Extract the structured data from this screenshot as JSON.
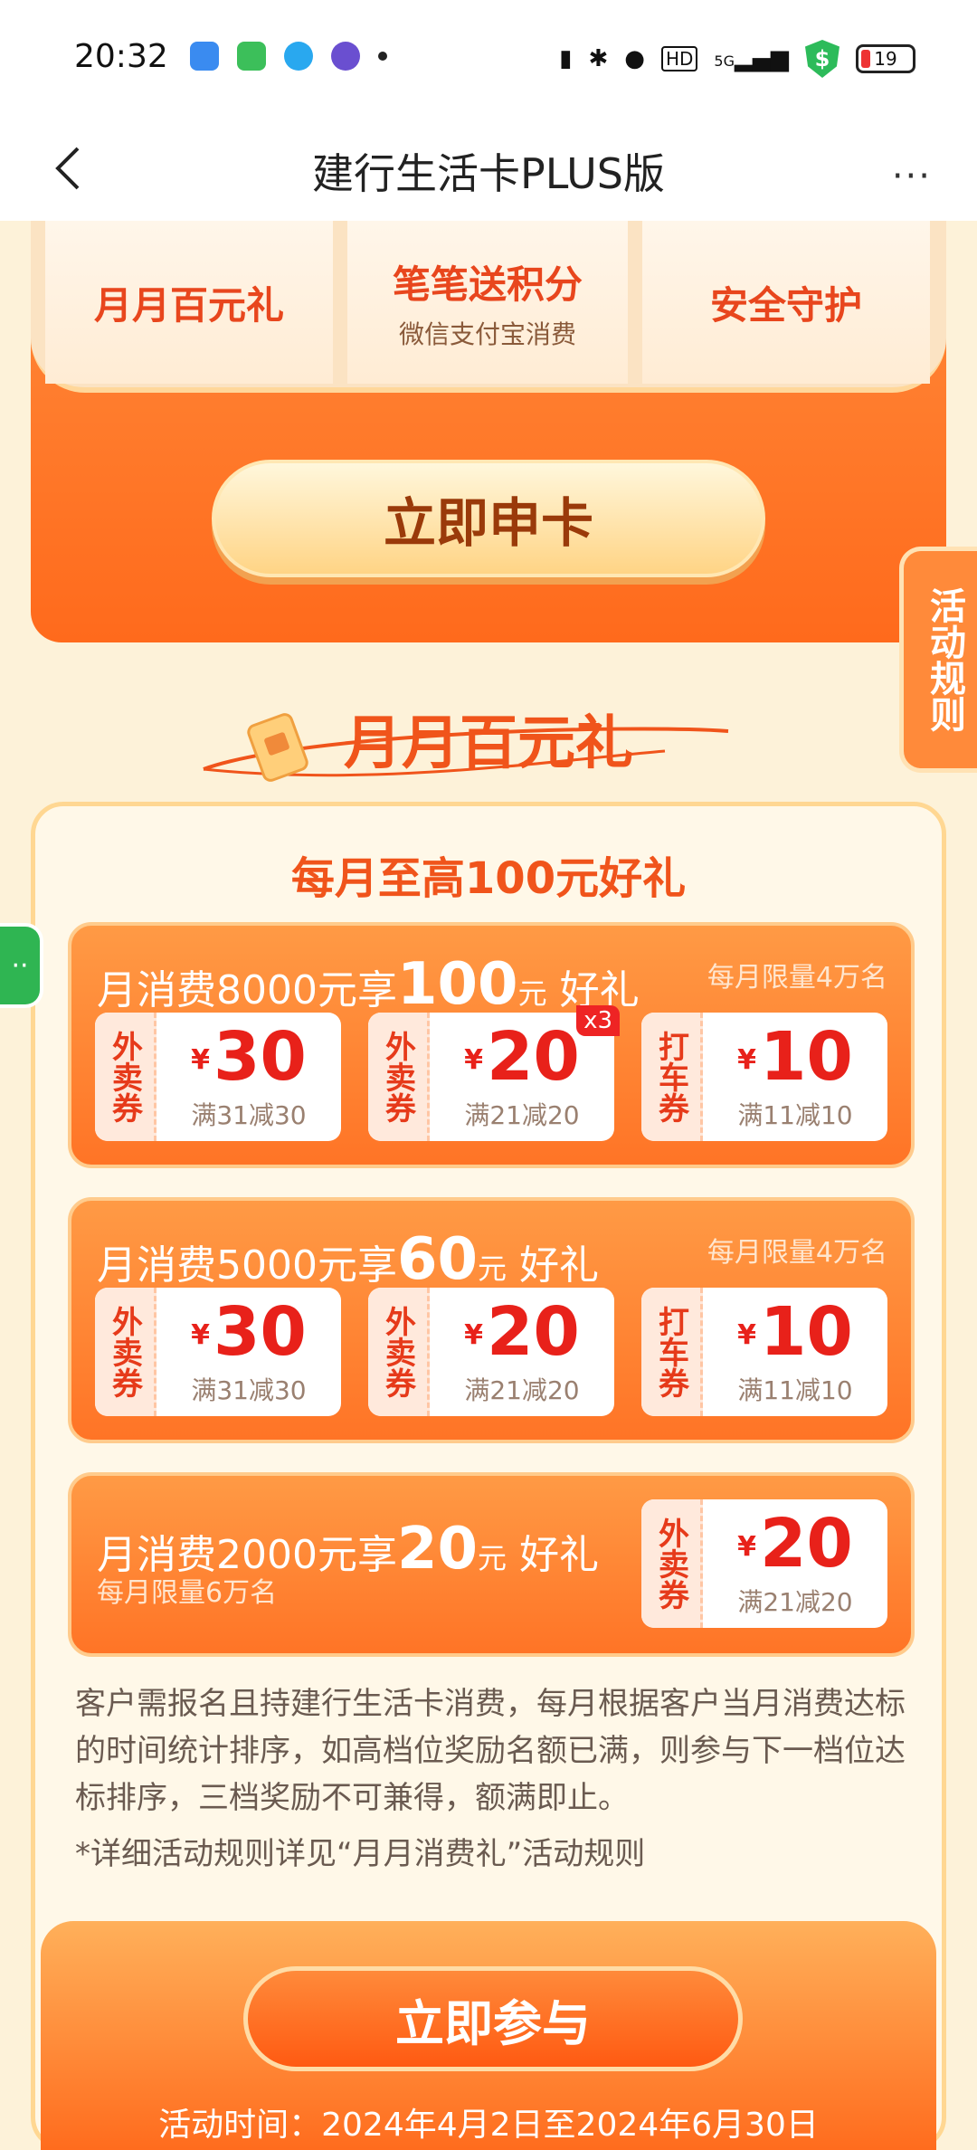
{
  "status_bar": {
    "time": "20:32",
    "battery": "19",
    "network": "5G",
    "hd": "HD",
    "shield_symbol": "$"
  },
  "titlebar": {
    "title": "建行生活卡PLUS版",
    "more": "···"
  },
  "features": [
    {
      "title": "月月百元礼",
      "sub": ""
    },
    {
      "title": "笔笔送积分",
      "sub": "微信支付宝消费"
    },
    {
      "title": "安全守护",
      "sub": ""
    }
  ],
  "apply_button": "立即申卡",
  "rules_tab": "活动规则",
  "section": {
    "title": "月月百元礼",
    "head": "每月至高100元好礼"
  },
  "tiers": [
    {
      "prefix": "月消费8000元享",
      "amount": "100",
      "unit": "元",
      "suffix": "好礼",
      "limit": "每月限量4万名",
      "coupons": [
        {
          "type": "外卖券",
          "value": "30",
          "cond": "满31减30",
          "badge": ""
        },
        {
          "type": "外卖券",
          "value": "20",
          "cond": "满21减20",
          "badge": "x3"
        },
        {
          "type": "打车券",
          "value": "10",
          "cond": "满11减10",
          "badge": ""
        }
      ]
    },
    {
      "prefix": "月消费5000元享",
      "amount": "60",
      "unit": "元",
      "suffix": "好礼",
      "limit": "每月限量4万名",
      "coupons": [
        {
          "type": "外卖券",
          "value": "30",
          "cond": "满31减30",
          "badge": ""
        },
        {
          "type": "外卖券",
          "value": "20",
          "cond": "满21减20",
          "badge": ""
        },
        {
          "type": "打车券",
          "value": "10",
          "cond": "满11减10",
          "badge": ""
        }
      ]
    },
    {
      "prefix": "月消费2000元享",
      "amount": "20",
      "unit": "元",
      "suffix": "好礼",
      "limit": "每月限量6万名",
      "coupons": [
        {
          "type": "外卖券",
          "value": "20",
          "cond": "满21减20",
          "badge": ""
        }
      ]
    }
  ],
  "currency_symbol": "¥",
  "description": "客户需报名且持建行生活卡消费，每月根据客户当月消费达标的时间统计排序，如高档位奖励名额已满，则参与下一档位达标排序，三档奖励不可兼得，额满即止。",
  "note": "*详细活动规则详见“月月消费礼”活动规则",
  "cta": {
    "label": "立即参与",
    "time": "活动时间：2024年4月2日至2024年6月30日"
  },
  "floating": "··",
  "icons": {
    "back": "back-arrow-icon",
    "more": "more-dots-icon",
    "gift": "gift-card-icon"
  },
  "colors": {
    "primary": "#ff7426",
    "accent_red": "#e8211a",
    "background": "#fdf2d9"
  }
}
